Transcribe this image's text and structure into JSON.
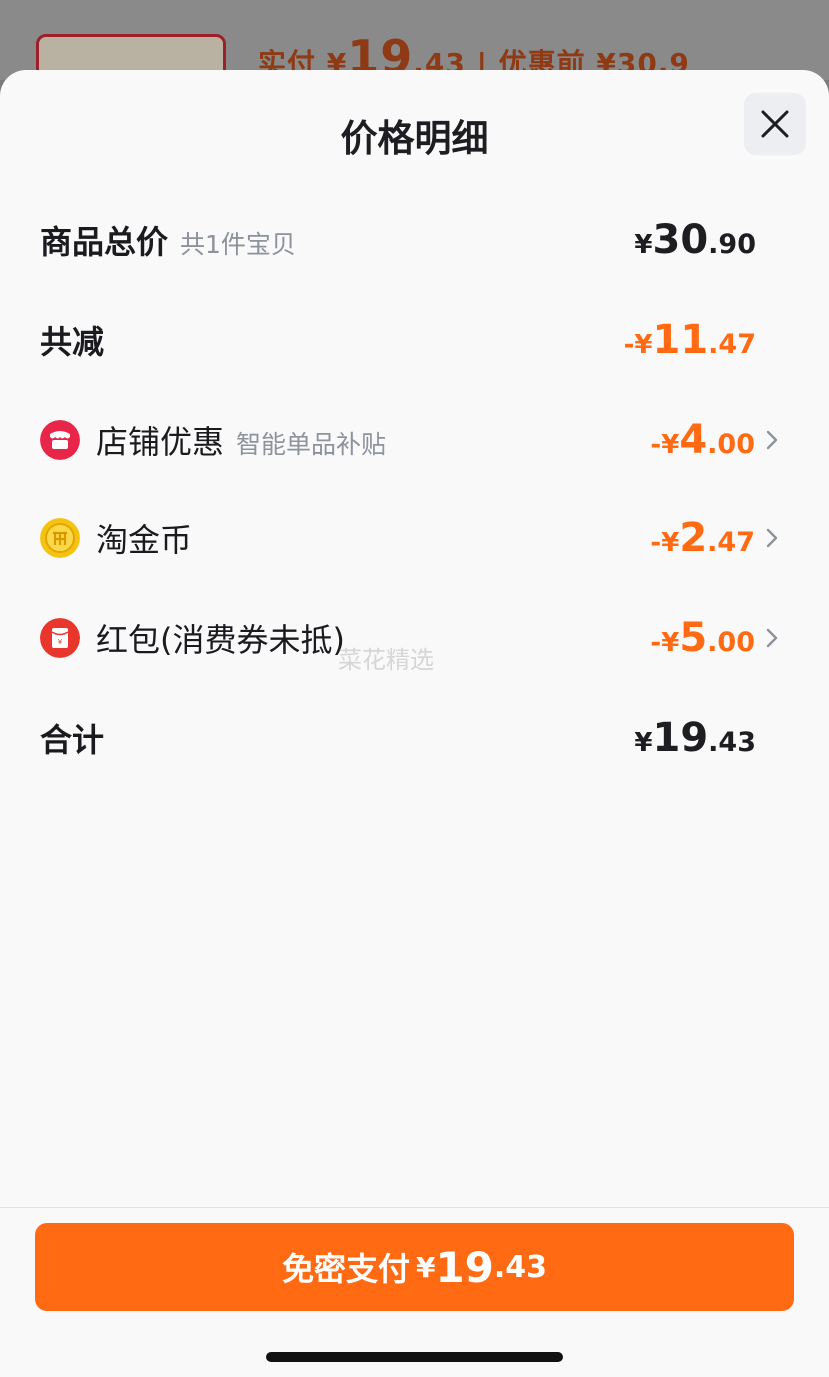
{
  "background": {
    "paid_label": "实付",
    "paid_symbol": "¥",
    "paid_int": "19",
    "paid_dec": ".43",
    "before_label": "| 优惠前 ¥30.9"
  },
  "sheet": {
    "title": "价格明细",
    "rows": {
      "total": {
        "label": "商品总价",
        "sub": "共1件宝贝",
        "sign": "",
        "symbol": "¥",
        "int": "30",
        "dec": ".90"
      },
      "reduce": {
        "label": "共减",
        "sign": "-",
        "symbol": "¥",
        "int": "11",
        "dec": ".47"
      },
      "shop": {
        "label": "店铺优惠",
        "sub": "智能单品补贴",
        "sign": "-",
        "symbol": "¥",
        "int": "4",
        "dec": ".00"
      },
      "coin": {
        "label": "淘金币",
        "sign": "-",
        "symbol": "¥",
        "int": "2",
        "dec": ".47"
      },
      "redpacket": {
        "label": "红包(消费券未抵)",
        "sign": "-",
        "symbol": "¥",
        "int": "5",
        "dec": ".00"
      },
      "sum": {
        "label": "合计",
        "sign": "",
        "symbol": "¥",
        "int": "19",
        "dec": ".43"
      }
    },
    "watermark": "菜花精选"
  },
  "pay_button": {
    "label": "免密支付",
    "symbol": "¥",
    "int": "19",
    "dec": ".43"
  },
  "colors": {
    "accent": "#ff6a13",
    "text": "#1d1d22",
    "muted": "#8d929c",
    "shop_icon": "#e8264a",
    "coin_icon": "#f5c20f",
    "redpacket_icon": "#e8362c"
  },
  "icons": {
    "close": "close-icon",
    "shop": "shop-icon",
    "coin": "coin-icon",
    "redpacket": "red-packet-icon",
    "chevron": "chevron-right-icon"
  }
}
